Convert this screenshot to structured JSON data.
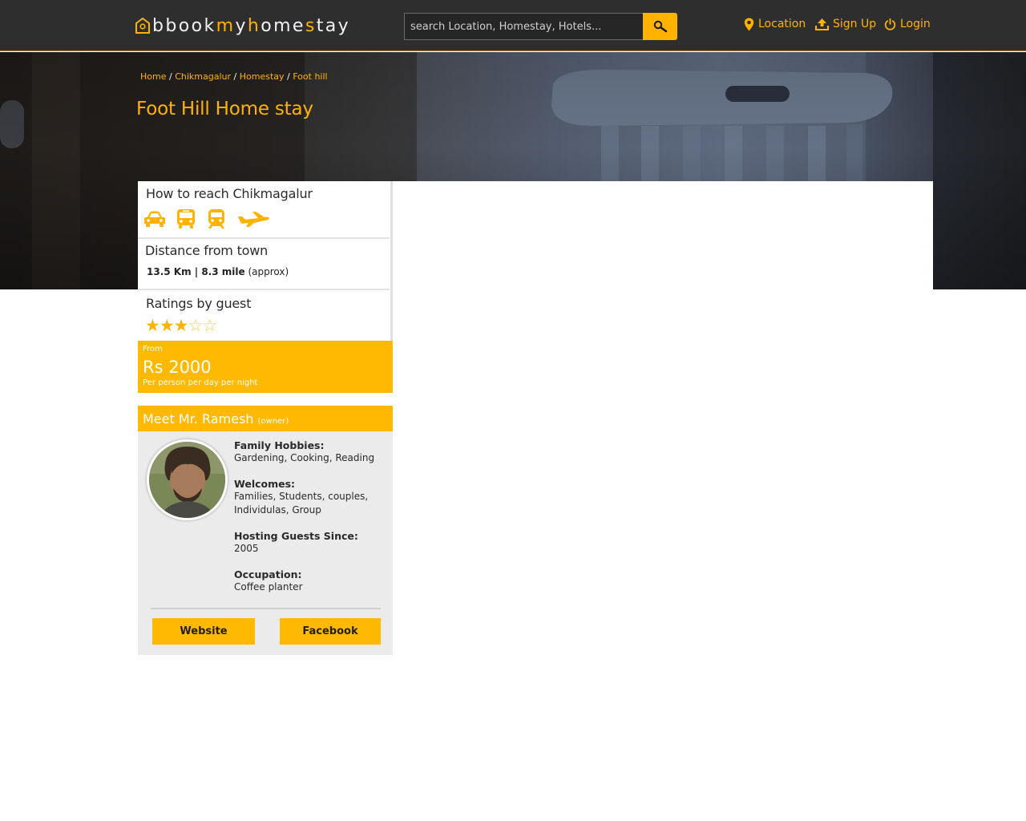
{
  "header": {
    "logo": {
      "prefix": "b",
      "parts": [
        "book",
        "m",
        "y",
        "h",
        "ome",
        "s",
        "tay"
      ]
    },
    "search": {
      "placeholder": "search Location, Homestay, Hotels..."
    },
    "nav": {
      "location": "Location",
      "signup": "Sign Up",
      "login": "Login"
    }
  },
  "breadcrumb": {
    "items": [
      "Home",
      "Chikmagalur",
      "Homestay",
      "Foot hill"
    ],
    "separator": "/"
  },
  "page_title": "Foot Hill Home stay",
  "reach": {
    "title": "How to reach Chikmagalur",
    "modes": [
      "car-icon",
      "bus-icon",
      "train-icon",
      "plane-icon"
    ]
  },
  "distance": {
    "title": "Distance from town",
    "value": "13.5 Km | 8.3 mile",
    "note": "(approx)"
  },
  "ratings": {
    "title": "Ratings by guest",
    "score": 3,
    "max": 5
  },
  "price": {
    "from_label": "From",
    "amount": "Rs 2000",
    "note": "Per person per day per night"
  },
  "owner": {
    "title": "Meet Mr. Ramesh",
    "subtitle": "(owner)",
    "hobbies_label": "Family Hobbies:",
    "hobbies": "Gardening, Cooking, Reading",
    "welcomes_label": "Welcomes:",
    "welcomes": "Families, Students, couples, Individulas, Group",
    "since_label": "Hosting Guests Since:",
    "since": "2005",
    "occupation_label": "Occupation:",
    "occupation": "Coffee planter",
    "website_button": "Website",
    "facebook_button": "Facebook"
  },
  "colors": {
    "accent": "#ffb900",
    "header_bg": "#2e2e2e",
    "panel_bg": "#ebebeb"
  }
}
